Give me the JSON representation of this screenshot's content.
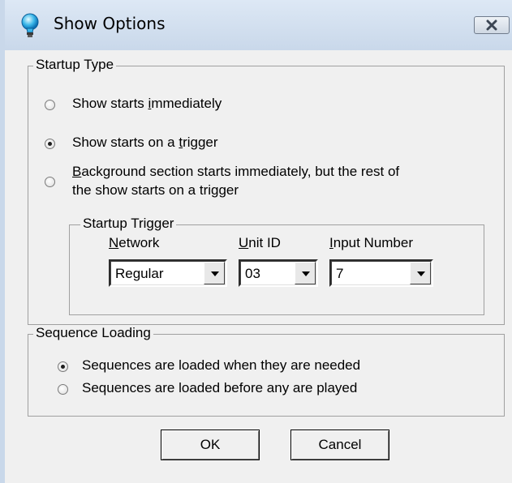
{
  "window": {
    "title": "Show Options",
    "icon": "lightbulb-icon",
    "close_icon": "close-icon"
  },
  "startup_type": {
    "legend": "Startup Type",
    "options": [
      {
        "pre": "Show starts ",
        "access": "i",
        "post": "mmediately",
        "checked": false
      },
      {
        "pre": "Show starts on a ",
        "access": "t",
        "post": "rigger",
        "checked": true
      },
      {
        "pre": "",
        "access": "B",
        "post": "ackground section starts immediately, but the rest of",
        "line2": "the show starts on a trigger",
        "checked": false
      }
    ]
  },
  "startup_trigger": {
    "legend": "Startup Trigger",
    "network": {
      "access": "N",
      "label_rest": "etwork",
      "value": "Regular"
    },
    "unit_id": {
      "access": "U",
      "label_rest": "nit ID",
      "value": "03"
    },
    "input_number": {
      "access": "I",
      "label_rest": "nput Number",
      "value": "7"
    }
  },
  "sequence_loading": {
    "legend": "Sequence Loading",
    "options": [
      {
        "label": "Sequences are loaded when they are needed",
        "checked": true
      },
      {
        "label": "Sequences are loaded before any are played",
        "checked": false
      }
    ]
  },
  "buttons": {
    "ok": "OK",
    "cancel": "Cancel"
  }
}
